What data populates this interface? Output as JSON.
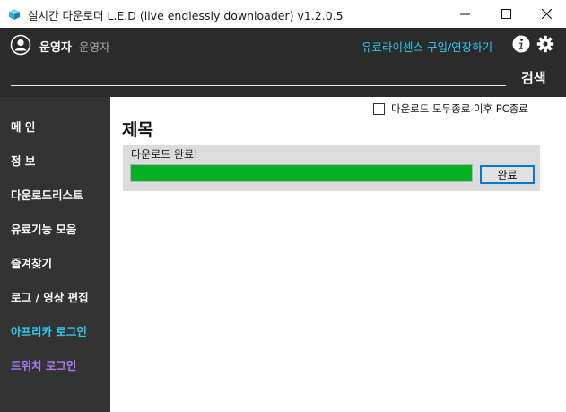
{
  "window": {
    "title": "실시간 다운로더 L.E.D (live endlessly downloader) v1.2.0.5"
  },
  "header": {
    "user_name": "운영자",
    "user_role": "운영자",
    "license_link": "유료라이센스 구입/연장하기",
    "search_placeholder": "",
    "search_label": "검색"
  },
  "sidebar": {
    "items": [
      {
        "label": "메 인",
        "color": "#ffffff"
      },
      {
        "label": "정 보",
        "color": "#ffffff"
      },
      {
        "label": "다운로드리스트",
        "color": "#ffffff"
      },
      {
        "label": "유료기능 모음",
        "color": "#ffffff"
      },
      {
        "label": "즐겨찾기",
        "color": "#ffffff"
      },
      {
        "label": "로그 / 영상 편집",
        "color": "#ffffff"
      },
      {
        "label": "아프리카 로그인",
        "color": "#35c6e8"
      },
      {
        "label": "트위치 로그인",
        "color": "#a97bf5"
      }
    ]
  },
  "main": {
    "shutdown_label": "다운로드 모두종료 이후 PC종료",
    "shutdown_checked": false,
    "title": "제목",
    "download": {
      "status": "다운로드 완료!",
      "progress_percent": 100,
      "done_label": "완료"
    }
  },
  "colors": {
    "header_bg": "#2b2b2b",
    "sidebar_bg": "#333333",
    "accent_cyan": "#35c6e8",
    "accent_purple": "#a97bf5",
    "progress_green": "#06b025"
  }
}
